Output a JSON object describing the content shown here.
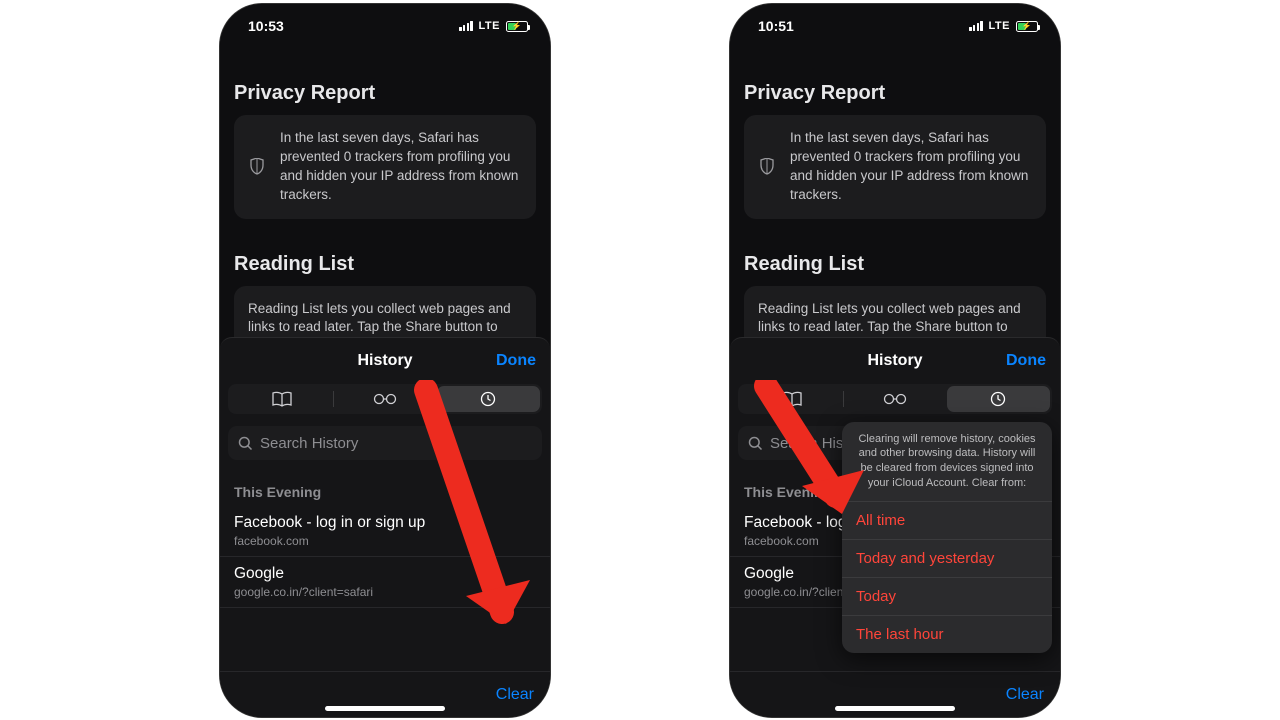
{
  "left": {
    "status": {
      "time": "10:53",
      "net": "LTE"
    },
    "privacy": {
      "title": "Privacy Report",
      "body": "In the last seven days, Safari has prevented 0 trackers from profiling you and hidden your IP address from known trackers."
    },
    "reading": {
      "title": "Reading List",
      "body": "Reading List lets you collect web pages and links to read later. Tap the Share button to add the current page."
    },
    "sheet": {
      "title": "History",
      "done": "Done",
      "search_placeholder": "Search History",
      "section": "This Evening",
      "rows": [
        {
          "title": "Facebook - log in or sign up",
          "sub": "facebook.com"
        },
        {
          "title": "Google",
          "sub": "google.co.in/?client=safari"
        }
      ],
      "clear": "Clear"
    }
  },
  "right": {
    "status": {
      "time": "10:51",
      "net": "LTE"
    },
    "privacy": {
      "title": "Privacy Report",
      "body": "In the last seven days, Safari has prevented 0 trackers from profiling you and hidden your IP address from known trackers."
    },
    "reading": {
      "title": "Reading List",
      "body": "Reading List lets you collect web pages and links to read later. Tap the Share button to add the current page."
    },
    "sheet": {
      "title": "History",
      "done": "Done",
      "search_placeholder": "Search History",
      "section": "This Evening",
      "rows": [
        {
          "title": "Facebook - log in or sign up",
          "sub": "facebook.com"
        },
        {
          "title": "Google",
          "sub": "google.co.in/?client=safari"
        }
      ],
      "clear": "Clear"
    },
    "popover": {
      "note": "Clearing will remove history, cookies and other browsing data. History will be cleared from devices signed into your iCloud Account. Clear from:",
      "items": [
        "All time",
        "Today and yesterday",
        "Today",
        "The last hour"
      ]
    }
  }
}
